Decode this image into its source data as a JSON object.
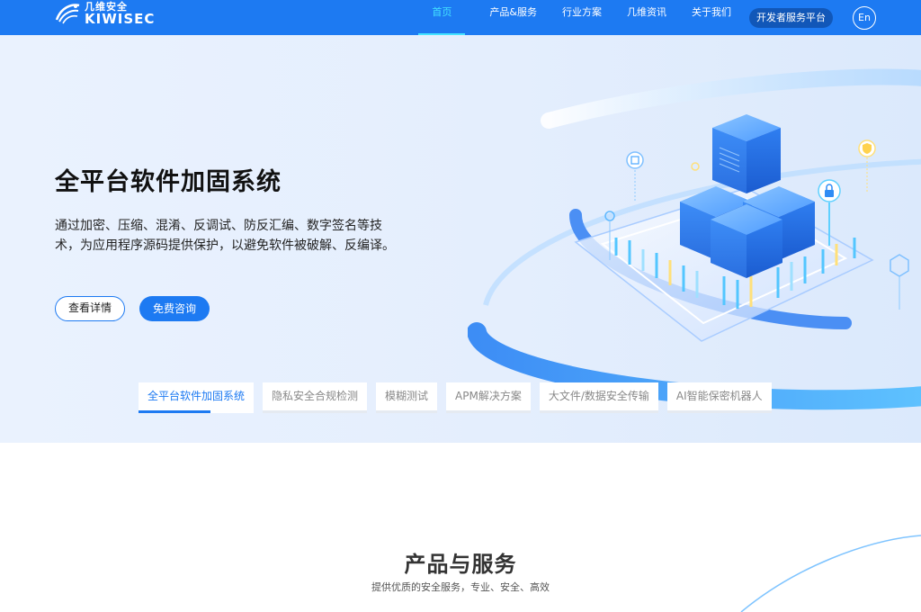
{
  "brand": {
    "name_cn": "几维安全",
    "name_en": "KIWISEC"
  },
  "nav": {
    "items": [
      "首页",
      "产品&服务",
      "行业方案",
      "几维资讯",
      "关于我们"
    ],
    "developer_button": "开发者服务平台",
    "lang_label": "En"
  },
  "hero": {
    "title": "全平台软件加固系统",
    "description": "通过加密、压缩、混淆、反调试、防反汇编、数字签名等技术，为应用程序源码提供保护，以避免软件被破解、反编译。",
    "details_button": "查看详情",
    "consult_button": "免费咨询"
  },
  "tabs": [
    "全平台软件加固系统",
    "隐私安全合规检测",
    "模糊测试",
    "APM解决方案",
    "大文件/数据安全传输",
    "AI智能保密机器人"
  ],
  "section": {
    "title": "产品与服务",
    "subtitle": "提供优质的安全服务，专业、安全、高效"
  },
  "colors": {
    "primary": "#1d7af2",
    "header_bg": "#1d7af2",
    "nav_active": "#44e3ff",
    "hero_bg": "#e6effd"
  }
}
